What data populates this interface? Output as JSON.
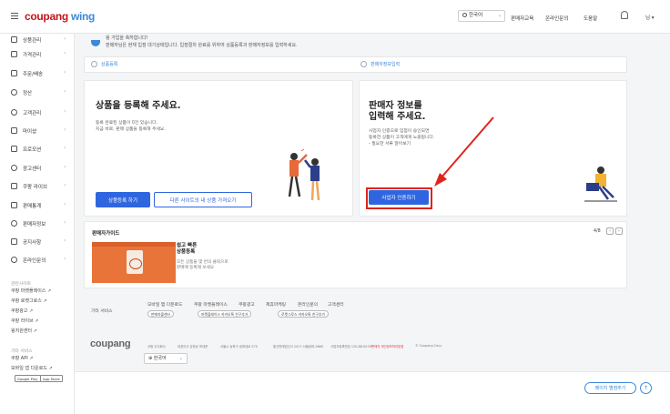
{
  "header": {
    "logo_coupang": "coupang",
    "logo_wing": "wing",
    "language": "한국어",
    "links": [
      "판매자교육",
      "온라인문의",
      "도움말"
    ],
    "user_menu": "님 ▾"
  },
  "sidebar": {
    "items": [
      {
        "label": "상품관리",
        "icon": "box-icon"
      },
      {
        "label": "가격관리",
        "icon": "price-tag-icon"
      },
      {
        "label": "주문/배송",
        "icon": "truck-icon"
      },
      {
        "label": "정산",
        "icon": "coin-icon"
      },
      {
        "label": "고객관리",
        "icon": "chat-icon"
      },
      {
        "label": "마이샵",
        "icon": "shop-icon"
      },
      {
        "label": "프로모션",
        "icon": "gift-icon"
      },
      {
        "label": "광고센터",
        "icon": "megaphone-icon"
      },
      {
        "label": "쿠팡 라이브",
        "icon": "live-icon"
      },
      {
        "label": "판매통계",
        "icon": "chart-icon"
      },
      {
        "label": "판매자정보",
        "icon": "user-icon"
      },
      {
        "label": "공지사항",
        "icon": "notice-icon"
      },
      {
        "label": "온라인문의",
        "icon": "headset-icon"
      }
    ],
    "section1_title": "관련사이트",
    "section1_links": [
      "쿠팡 마켓플레이스 ↗",
      "쿠팡 로켓그로스 ↗",
      "쿠팡광고 ↗",
      "쿠팡 라이브 ↗",
      "윙지원센터 ↗"
    ],
    "section2_title": "기타 서비스",
    "section2_links": [
      "쿠팡 API ↗",
      "모바일 앱 다운로드 ↗"
    ],
    "store_badges": [
      "Google Play",
      "App Store"
    ]
  },
  "notice": {
    "line1": "윙 가입을 축하합니다!",
    "line2": "판매자님은 현재 입점 대기상태입니다. 입점절차 완료를 위하여 상품등록과 판매자정보를 입력하세요."
  },
  "steps": [
    "상품등록",
    "판매자정보입력"
  ],
  "product_card": {
    "title": "상품을 등록해 주세요.",
    "desc1": "등록 완료된 상품이 0건 있습니다.",
    "desc2": "지금 바로, 판매 상품을 등록해 주세요.",
    "primary_button": "상품등록 하기",
    "secondary_button": "다른 사이트의 내 상품 가져오기"
  },
  "seller_card": {
    "title1": "판매자 정보를",
    "title2": "입력해 주세요.",
    "desc1": "사업자 인증으로 입점이 승인되면",
    "desc2": "등록한 상품이 고객에게 노출됩니다.",
    "desc3": "- 필요한 서류 알아보기",
    "button": "사업자 인증하기"
  },
  "guide": {
    "title": "판매자가이드",
    "page": "4/8",
    "item_title1": "쉽고 빠른",
    "item_title2": "상품등록",
    "item_desc1": "모든 상품을 몇 번의 클릭으로",
    "item_desc2": "판매에 등록해 보세요"
  },
  "footer": {
    "other_services": "기타 서비스",
    "links": [
      "모바일 앱 다운로드",
      "쿠팡 마켓플레이스",
      "쿠팡광고",
      "제휴마케팅",
      "온라인문의",
      "고객센터"
    ],
    "chips": [
      "판매자콜센터",
      "마켓플레이스 카카오톡 친구추가",
      "로켓그로스 카카오톡 친구추가"
    ],
    "brand": "coupang",
    "small": [
      "쿠팡 주식회사",
      "대표이사 강한승 박대준",
      "서울시 송파구 송파대로 570",
      "통신판매업신고 2017-서울송파-0680",
      "사업자등록번호 120-88-00767",
      "판매자 개인정보처리방침",
      "© Coupang Corp."
    ],
    "language": "한국어"
  },
  "bottom": {
    "page_move": "페이지 별점주기",
    "top": "↑"
  }
}
